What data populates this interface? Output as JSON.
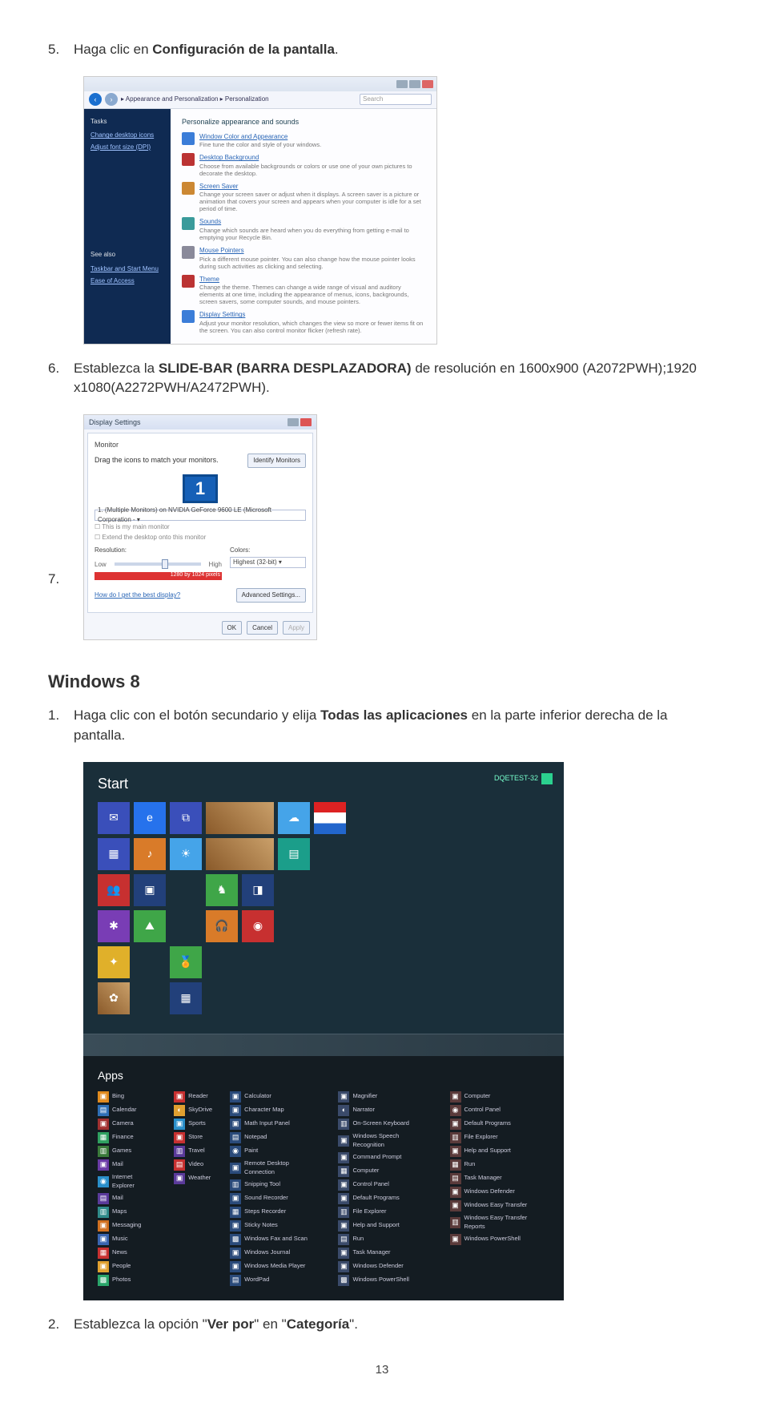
{
  "steps": {
    "s5_num": "5.",
    "s5_a": "Haga clic en ",
    "s5_b": "Configuración de la pantalla",
    "s5_c": ".",
    "s6_num": "6.",
    "s6_a": "Establezca la ",
    "s6_b": "SLIDE-BAR (BARRA DESPLAZADORA)",
    "s6_c": " de resolución en 1600x900 (A2072PWH);1920 x1080(A2272PWH/A2472PWH).",
    "s7_num": "7.",
    "w8_h": "Windows 8",
    "w81_num": "1.",
    "w81_a": "Haga clic con el botón secundario y elija ",
    "w81_b": "Todas las aplicaciones",
    "w81_c": " en la parte inferior derecha de la pantalla.",
    "w82_num": "2.",
    "w82_a": "Establezca la opción \"",
    "w82_b": "Ver por",
    "w82_c": "\" en \"",
    "w82_d": "Categoría",
    "w82_e": "\"."
  },
  "personalize": {
    "crumb": "▸ Appearance and Personalization ▸ Personalization",
    "search_ph": "Search",
    "side_h": "Tasks",
    "side_l1": "Change desktop icons",
    "side_l2": "Adjust font size (DPI)",
    "side_b1": "See also",
    "side_b2": "Taskbar and Start Menu",
    "side_b3": "Ease of Access",
    "title": "Personalize appearance and sounds",
    "items": [
      {
        "h": "Window Color and Appearance",
        "d": "Fine tune the color and style of your windows."
      },
      {
        "h": "Desktop Background",
        "d": "Choose from available backgrounds or colors or use one of your own pictures to decorate the desktop."
      },
      {
        "h": "Screen Saver",
        "d": "Change your screen saver or adjust when it displays. A screen saver is a picture or animation that covers your screen and appears when your computer is idle for a set period of time."
      },
      {
        "h": "Sounds",
        "d": "Change which sounds are heard when you do everything from getting e-mail to emptying your Recycle Bin."
      },
      {
        "h": "Mouse Pointers",
        "d": "Pick a different mouse pointer. You can also change how the mouse pointer looks during such activities as clicking and selecting."
      },
      {
        "h": "Theme",
        "d": "Change the theme. Themes can change a wide range of visual and auditory elements at one time, including the appearance of menus, icons, backgrounds, screen savers, some computer sounds, and mouse pointers."
      },
      {
        "h": "Display Settings",
        "d": "Adjust your monitor resolution, which changes the view so more or fewer items fit on the screen. You can also control monitor flicker (refresh rate)."
      }
    ]
  },
  "display": {
    "title": "Display Settings",
    "tab": "Monitor",
    "drag": "Drag the icons to match your monitors.",
    "identify": "Identify Monitors",
    "monitor_num": "1",
    "dropdown": "1. (Multiple Monitors) on NVIDIA GeForce 9600 LE (Microsoft Corporation - ▾",
    "chk1": "This is my main monitor",
    "chk2": "Extend the desktop onto this monitor",
    "res_label": "Resolution:",
    "low": "Low",
    "high": "High",
    "red": "1280 by 1024 pixels",
    "colors_label": "Colors:",
    "colors_val": "Highest (32-bit)    ▾",
    "bestlink": "How do I get the best display?",
    "adv": "Advanced Settings...",
    "ok": "OK",
    "cancel": "Cancel",
    "apply": "Apply"
  },
  "w8start": {
    "title": "Start",
    "user": "DQETEST-32",
    "apps_title": "Apps"
  },
  "apps": {
    "col1": [
      {
        "c": "#e08a1e",
        "g": "▣",
        "t": "Bing"
      },
      {
        "c": "#2f6fb5",
        "g": "▤",
        "t": "Calendar"
      },
      {
        "c": "#a03030",
        "g": "▣",
        "t": "Camera"
      },
      {
        "c": "#2fa060",
        "g": "▦",
        "t": "Finance"
      },
      {
        "c": "#3a7a3a",
        "g": "▥",
        "t": "Games"
      },
      {
        "c": "#6a3aa5",
        "g": "▣",
        "t": "Mail"
      },
      {
        "c": "#2a8fca",
        "g": "◉",
        "t": "Internet Explorer"
      },
      {
        "c": "#5a3a9a",
        "g": "▤",
        "t": "Mail"
      },
      {
        "c": "#2f8a8a",
        "g": "▥",
        "t": "Maps"
      },
      {
        "c": "#d07020",
        "g": "▣",
        "t": "Messaging"
      },
      {
        "c": "#3a65b0",
        "g": "▣",
        "t": "Music"
      },
      {
        "c": "#c73030",
        "g": "▦",
        "t": "News"
      },
      {
        "c": "#e0a030",
        "g": "▣",
        "t": "People"
      },
      {
        "c": "#2aa56a",
        "g": "▩",
        "t": "Photos"
      }
    ],
    "col2": [
      {
        "c": "#c73030",
        "g": "▣",
        "t": "Reader"
      },
      {
        "c": "#e0a030",
        "g": "◐",
        "t": "SkyDrive"
      },
      {
        "c": "#2a8fca",
        "g": "▣",
        "t": "Sports"
      },
      {
        "c": "#c73030",
        "g": "▣",
        "t": "Store"
      },
      {
        "c": "#5a3a9a",
        "g": "▥",
        "t": "Travel"
      },
      {
        "c": "#c73030",
        "g": "▤",
        "t": "Video"
      },
      {
        "c": "#5a3a9a",
        "g": "▣",
        "t": "Weather"
      }
    ],
    "col3": [
      {
        "c": "#2a4a7a",
        "g": "▣",
        "t": "Calculator"
      },
      {
        "c": "#2a4a7a",
        "g": "▣",
        "t": "Character Map"
      },
      {
        "c": "#2a4a7a",
        "g": "▣",
        "t": "Math Input Panel"
      },
      {
        "c": "#2a4a7a",
        "g": "▤",
        "t": "Notepad"
      },
      {
        "c": "#2a4a7a",
        "g": "◉",
        "t": "Paint"
      },
      {
        "c": "#2a4a7a",
        "g": "▣",
        "t": "Remote Desktop Connection"
      },
      {
        "c": "#2a4a7a",
        "g": "▥",
        "t": "Snipping Tool"
      },
      {
        "c": "#2a4a7a",
        "g": "▣",
        "t": "Sound Recorder"
      },
      {
        "c": "#2a4a7a",
        "g": "▦",
        "t": "Steps Recorder"
      },
      {
        "c": "#2a4a7a",
        "g": "▣",
        "t": "Sticky Notes"
      },
      {
        "c": "#2a4a7a",
        "g": "▩",
        "t": "Windows Fax and Scan"
      },
      {
        "c": "#2a4a7a",
        "g": "▣",
        "t": "Windows Journal"
      },
      {
        "c": "#2a4a7a",
        "g": "▣",
        "t": "Windows Media Player"
      },
      {
        "c": "#2a4a7a",
        "g": "▤",
        "t": "WordPad"
      }
    ],
    "col4": [
      {
        "c": "#3a4a6a",
        "g": "▣",
        "t": "Magnifier"
      },
      {
        "c": "#3a4a6a",
        "g": "◐",
        "t": "Narrator"
      },
      {
        "c": "#3a4a6a",
        "g": "▥",
        "t": "On-Screen Keyboard"
      },
      {
        "c": "#3a4a6a",
        "g": "▣",
        "t": "Windows Speech Recognition"
      },
      {
        "c": "#3a4a6a",
        "g": "▣",
        "t": "Command Prompt"
      },
      {
        "c": "#3a4a6a",
        "g": "▦",
        "t": "Computer"
      },
      {
        "c": "#3a4a6a",
        "g": "▣",
        "t": "Control Panel"
      },
      {
        "c": "#3a4a6a",
        "g": "▣",
        "t": "Default Programs"
      },
      {
        "c": "#3a4a6a",
        "g": "▥",
        "t": "File Explorer"
      },
      {
        "c": "#3a4a6a",
        "g": "▣",
        "t": "Help and Support"
      },
      {
        "c": "#3a4a6a",
        "g": "▤",
        "t": "Run"
      },
      {
        "c": "#3a4a6a",
        "g": "▣",
        "t": "Task Manager"
      },
      {
        "c": "#3a4a6a",
        "g": "▣",
        "t": "Windows Defender"
      },
      {
        "c": "#3a4a6a",
        "g": "▩",
        "t": "Windows PowerShell"
      }
    ],
    "col5": [
      {
        "c": "#5a3a3a",
        "g": "▣",
        "t": "Computer"
      },
      {
        "c": "#5a3a3a",
        "g": "◉",
        "t": "Control Panel"
      },
      {
        "c": "#5a3a3a",
        "g": "▣",
        "t": "Default Programs"
      },
      {
        "c": "#5a3a3a",
        "g": "▥",
        "t": "File Explorer"
      },
      {
        "c": "#5a3a3a",
        "g": "▣",
        "t": "Help and Support"
      },
      {
        "c": "#5a3a3a",
        "g": "▦",
        "t": "Run"
      },
      {
        "c": "#5a3a3a",
        "g": "▤",
        "t": "Task Manager"
      },
      {
        "c": "#5a3a3a",
        "g": "▣",
        "t": "Windows Defender"
      },
      {
        "c": "#5a3a3a",
        "g": "▣",
        "t": "Windows Easy Transfer"
      },
      {
        "c": "#5a3a3a",
        "g": "▥",
        "t": "Windows Easy Transfer Reports"
      },
      {
        "c": "#5a3a3a",
        "g": "▣",
        "t": "Windows PowerShell"
      }
    ]
  },
  "page_num": "13"
}
